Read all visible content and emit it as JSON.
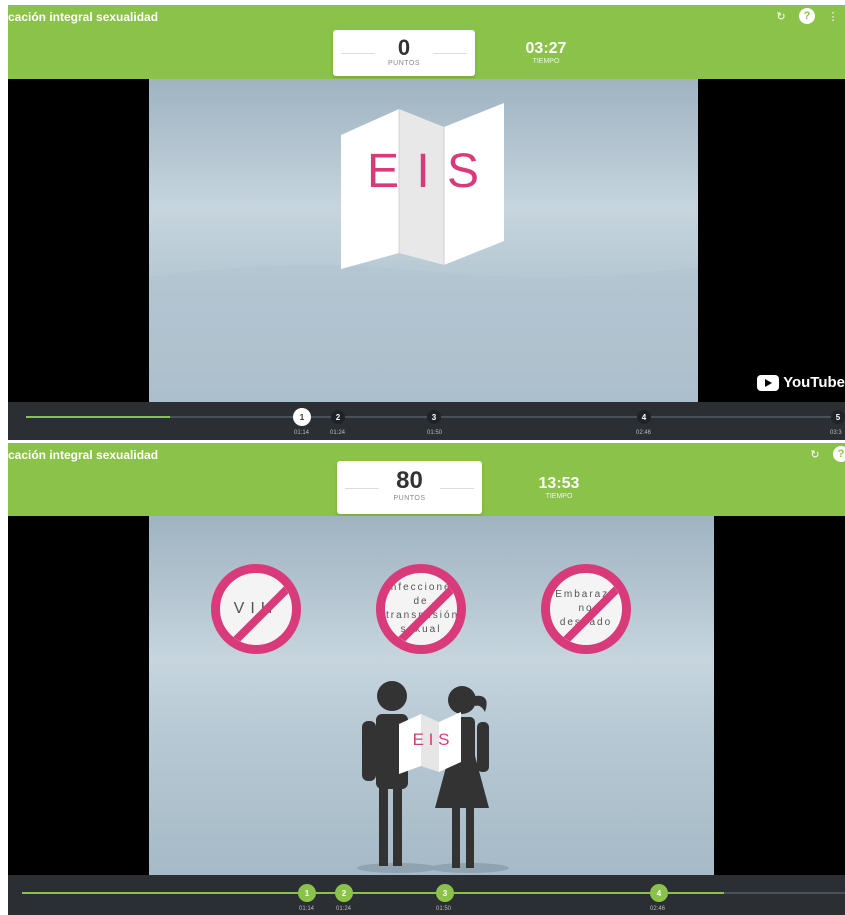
{
  "app": {
    "title": "cación integral sexualidad",
    "title2": "cación integral sexualidad"
  },
  "panel1": {
    "score": {
      "value": "0",
      "label": "PUNTOS"
    },
    "time": {
      "value": "03:27",
      "label": "TIEMPO"
    },
    "sign_letters": "E I S",
    "watermark": "YouTube",
    "timeline": {
      "points": [
        {
          "n": "1",
          "time": "01:14"
        },
        {
          "n": "2",
          "time": "01:24"
        },
        {
          "n": "3",
          "time": "01:50"
        },
        {
          "n": "4",
          "time": "02:46"
        },
        {
          "n": "5",
          "time": "03:3"
        }
      ]
    }
  },
  "panel2": {
    "score": {
      "value": "80",
      "label": "PUNTOS"
    },
    "time": {
      "value": "13:53",
      "label": "TIEMPO"
    },
    "bans": [
      {
        "text": "VIH"
      },
      {
        "text": "Infecciones de transmisión sexual"
      },
      {
        "text": "Embarazo no deseado"
      }
    ],
    "sign_small": "E I S",
    "timeline": {
      "points": [
        {
          "n": "1",
          "time": "01:14"
        },
        {
          "n": "2",
          "time": "01:24"
        },
        {
          "n": "3",
          "time": "01:50"
        },
        {
          "n": "4",
          "time": "02:46"
        }
      ]
    }
  },
  "colors": {
    "accent": "#8bc34a",
    "magenta": "#d83a7a",
    "dark_bar": "#2b2f33"
  },
  "icons": [
    "refresh-icon",
    "help-icon",
    "youtube-icon"
  ]
}
